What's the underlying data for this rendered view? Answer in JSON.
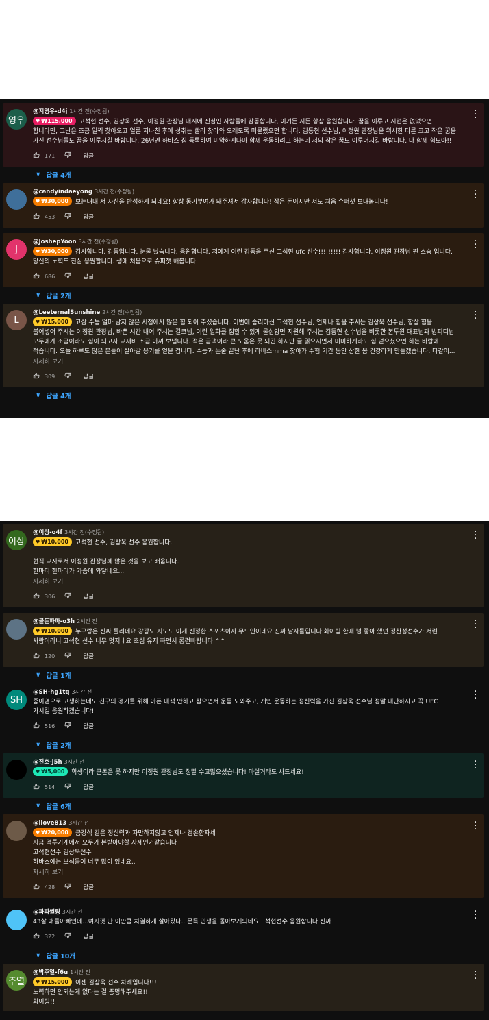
{
  "actions": {
    "reply_label": "답글",
    "see_more_label": "자세히 보기"
  },
  "panel1": {
    "comments": [
      {
        "handle": "@지영우-d4j",
        "time": "1시간 전(수정됨)",
        "avatar_text": "영우",
        "avatar_color": "#1b5e4a",
        "chip": "₩115,000",
        "chip_color": "#e91e63",
        "chip_text_color": "#ffffff",
        "bg": "#2a1416",
        "text": [
          "고석현 선수, 김상욱 선수, 이정원 관장님 매시에 진심인 사람들에 감동합니다, 이기든 지든 항상 응원합니다. 꿈을 이루고 시련은 없었으면 합니다만, 고난은 조금 일찍 찾아오고 얼른 지나친 후에 성취는 빨리 찾아와 오래도록 머물렀으면 합니다. 김동현 선수님, 이정원 관장님을 위시한 다른 크고 작은 꿈을 가진 선수님들도 꿈을 이루시길 바랍니다. 26년엔 하바스 짐 등록하여 미약하게나마 함께 운동하려고 하는데 저의 작은 꿈도 이루어지길 바랍니다. 다 함께 힘모아!!"
        ],
        "likes": "171",
        "replies": "답글 4개"
      },
      {
        "handle": "@candyindaeyong",
        "time": "3시간 전(수정됨)",
        "avatar_text": "",
        "avatar_color": "#3f6f9a",
        "chip": "₩30,000",
        "chip_color": "#f57c00",
        "chip_text_color": "#ffffff",
        "bg": "#2a1c10",
        "text": [
          "보는내내 저 자신을 반성하게 되네요! 항상 동기부여가 돼주셔서 감사합니다! 작은 돈이지만 저도 처음 슈퍼챗 보내봅니다!"
        ],
        "likes": "453",
        "replies": ""
      },
      {
        "handle": "@JoshepYoon",
        "time": "3시간 전(수정됨)",
        "avatar_text": "J",
        "avatar_color": "#e2336b",
        "chip": "₩30,000",
        "chip_color": "#f57c00",
        "chip_text_color": "#ffffff",
        "bg": "#2a1c10",
        "text": [
          "감사합니다. 감동입니다. 눈물 났습니다. 응원합니다. 저에게 이런 감동을 주신 고석현 ufc 선수!!!!!!!!! 감사합니다. 이정원 관장님 찐 스승 입니다. 당신의 노력도 진심 응원합니다. 생애 처음으로 슈퍼챗 해봅니다."
        ],
        "likes": "686",
        "replies": "답글 2개"
      },
      {
        "handle": "@LeeternalSunshine",
        "time": "2시간 전(수정됨)",
        "avatar_text": "L",
        "avatar_color": "#795548",
        "chip": "₩15,000",
        "chip_color": "#ffca28",
        "chip_text_color": "#2a1a00",
        "bg": "#272118",
        "text": [
          "고삼 수능 얼마 남지 않은 시점에서 많은 힘 되어 주셨습니다. 이번에 승리하신 고석현 선수님, 언제나 힘을 주시는 김상욱 선수님, 항상 힘을 불어넣어 주시는 이정원 관장님, 바쁜 시간 내어 주시는 컬크님, 이런 일화를 접할 수 있게 물심양면 지원해 주시는 김동현 선수님을 비롯한 본투윈 대표님과 방피디님 모두에게 조금이라도 힘이 되고자 교재비 조금 아껴 보냅니다. 적은 금액이라 큰 도움은 못 되긴 하지만 글 읽으시면서 미미하게라도 힘 얻으셨으면 하는 바람에 적습니다. 오늘 하루도 많은 분들이 살아갈 용기를 얻을 겁니다. 수능과 논술 끝난 후에 하바스mma 찾아가 수험 기간 동안 상한 몸 건강하게 만들겠습니다. 다같이..."
        ],
        "more": true,
        "likes": "309",
        "replies": "답글 4개"
      }
    ]
  },
  "panel2": {
    "comments": [
      {
        "handle": "@이상-o4f",
        "time": "3시간 전(수정됨)",
        "avatar_text": "이상",
        "avatar_color": "#33691e",
        "chip": "₩10,000",
        "chip_color": "#ffca28",
        "chip_text_color": "#2a1a00",
        "bg": "#272118",
        "text": [
          "고석현 선수, 김상욱 선수 응원합니다.",
          "",
          "현직 교사로서 이정원 관장님께 많은 것을 보고 배웁니다.",
          "한마디 한마디가 가슴에 와닿네요..."
        ],
        "more": true,
        "likes": "306",
        "replies": ""
      },
      {
        "handle": "@골든파파-o3h",
        "time": "2시간 전",
        "avatar_text": "",
        "avatar_color": "#5d7385",
        "chip": "₩10,000",
        "chip_color": "#ffca28",
        "chip_text_color": "#2a1a00",
        "bg": "#272118",
        "text": [
          "누구랑은 진짜 틀리네요 강광도 지도도 이게 진정한 스포츠이자 무도인이네요 진짜 남자들입니다 화이팅 한때 넘 좋아 했던 정찬성선수가 저런 사람이라니 고석현 선수 너무 멋지네요 초심 유지 하면서 롱런바랍니다 ^^"
        ],
        "likes": "120",
        "replies": "답글 1개"
      },
      {
        "handle": "@SH-hg1tq",
        "time": "3시간 전",
        "avatar_text": "SH",
        "avatar_color": "#00897b",
        "chip": "",
        "chip_color": "",
        "chip_text_color": "",
        "bg": "transparent",
        "text": [
          "중이염으로 고생하는데도 친구의 경기를 위해 아픈 내색 안하고 참으면서 운동 도와주고, 개인 운동하는 정신력을 가진 김상욱 선수님 정말 대단하시고 꼭 UFC 가시길 응원하겠습니다!"
        ],
        "likes": "516",
        "replies": "답글 2개"
      },
      {
        "handle": "@진호-j5h",
        "time": "3시간 전",
        "avatar_text": "",
        "avatar_color": "#000000",
        "chip": "₩5,000",
        "chip_color": "#1de9b6",
        "chip_text_color": "#003d30",
        "bg": "#0f2420",
        "text": [
          "학생이라 큰돈은 못 하지만 이정원 관장님도 정말 수고많으셨습니다! 마실거라도 사드세요!!"
        ],
        "likes": "514",
        "replies": "답글 6개"
      },
      {
        "handle": "@ilove813",
        "time": "3시간 전",
        "avatar_text": "",
        "avatar_color": "#6d5a48",
        "chip": "₩20,000",
        "chip_color": "#f57c00",
        "chip_text_color": "#ffffff",
        "bg": "#2a1c10",
        "text": [
          "금강석 같은 정신력과 자만하지않고 언제나 겸손한자세",
          "지금 격투기계에서 모두가 본받아야할 자세인거같습니다",
          "고석현선수 김상욱선수",
          "하바스에는 보석들이 너무 많이 있네요.."
        ],
        "more": true,
        "likes": "428",
        "replies": ""
      },
      {
        "handle": "@파파썰링",
        "time": "3시간 전",
        "avatar_text": "",
        "avatar_color": "#4fc3f7",
        "chip": "",
        "chip_color": "",
        "chip_text_color": "",
        "bg": "transparent",
        "text": [
          "43살 애들아빠인데...여지껏 난 이만큼 치열하게 살아왔나.. 문득 인생을 돌아보게되네요..  석현선수 응원합니다 진짜"
        ],
        "likes": "322",
        "replies": "답글 10개"
      },
      {
        "handle": "@박주열-f6u",
        "time": "1시간 전",
        "avatar_text": "주열",
        "avatar_color": "#558b2f",
        "chip": "₩15,000",
        "chip_color": "#ffca28",
        "chip_text_color": "#2a1a00",
        "bg": "#272118",
        "text": [
          "이젠 김상욱 선수 차례입니다!!!",
          "노력하면 안되는게 없다는 걸 증명해주세요!!",
          "화이팅!!"
        ],
        "likes": "",
        "replies": ""
      }
    ]
  }
}
